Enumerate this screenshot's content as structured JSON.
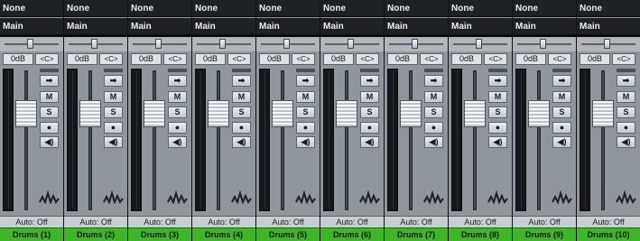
{
  "colors": {
    "strip_background": "#8f969d",
    "slot_background": "#1d2126",
    "channel_name_background": "#3fb52a"
  },
  "channels": [
    {
      "input": "None",
      "output": "Main",
      "volume": "0dB",
      "pan": "<C>",
      "automation": "Auto: Off",
      "name": "Drums (1)"
    },
    {
      "input": "None",
      "output": "Main",
      "volume": "0dB",
      "pan": "<C>",
      "automation": "Auto: Off",
      "name": "Drums (2)"
    },
    {
      "input": "None",
      "output": "Main",
      "volume": "0dB",
      "pan": "<C>",
      "automation": "Auto: Off",
      "name": "Drums (3)"
    },
    {
      "input": "None",
      "output": "Main",
      "volume": "0dB",
      "pan": "<C>",
      "automation": "Auto: Off",
      "name": "Drums (4)"
    },
    {
      "input": "None",
      "output": "Main",
      "volume": "0dB",
      "pan": "<C>",
      "automation": "Auto: Off",
      "name": "Drums (5)"
    },
    {
      "input": "None",
      "output": "Main",
      "volume": "0dB",
      "pan": "<C>",
      "automation": "Auto: Off",
      "name": "Drums (6)"
    },
    {
      "input": "None",
      "output": "Main",
      "volume": "0dB",
      "pan": "<C>",
      "automation": "Auto: Off",
      "name": "Drums (7)"
    },
    {
      "input": "None",
      "output": "Main",
      "volume": "0dB",
      "pan": "<C>",
      "automation": "Auto: Off",
      "name": "Drums (8)"
    },
    {
      "input": "None",
      "output": "Main",
      "volume": "0dB",
      "pan": "<C>",
      "automation": "Auto: Off",
      "name": "Drums (9)"
    },
    {
      "input": "None",
      "output": "Main",
      "volume": "0dB",
      "pan": "<C>",
      "automation": "Auto: Off",
      "name": "Drums (10)"
    }
  ],
  "buttons": {
    "mute": "M",
    "solo": "S",
    "route_icon": "arrow-right-icon",
    "record_icon": "record-dot-icon",
    "monitor_icon": "speaker-icon",
    "activity_icon": "waveform-icon"
  }
}
